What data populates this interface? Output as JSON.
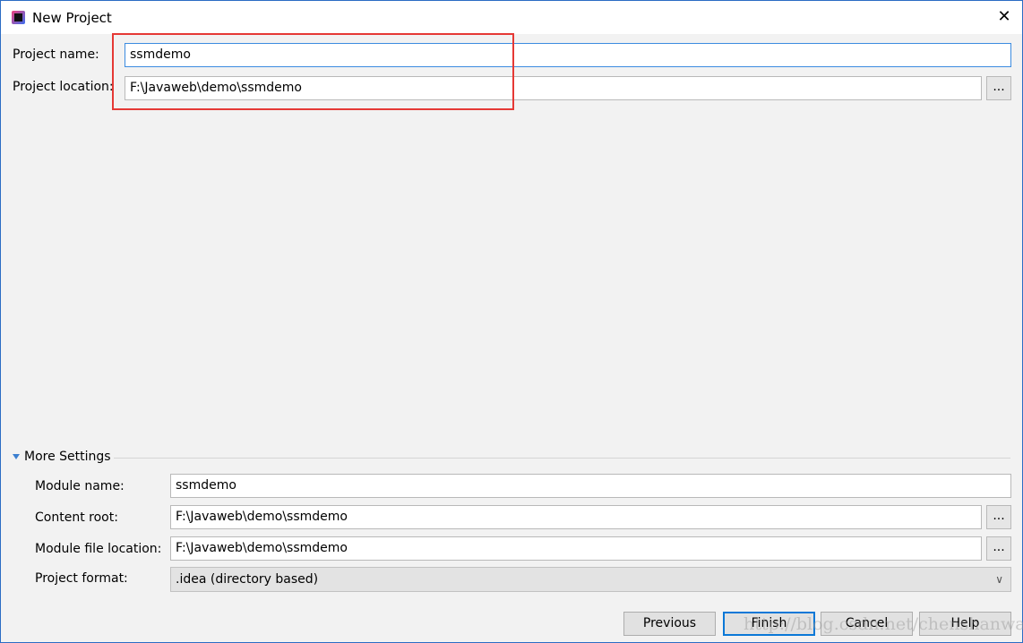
{
  "window": {
    "title": "New Project",
    "close": "✕"
  },
  "project": {
    "name_label": "Project name:",
    "name_value": "ssmdemo",
    "location_label": "Project location:",
    "location_value": "F:\\Javaweb\\demo\\ssmdemo",
    "browse": "..."
  },
  "more_settings": {
    "title": "More Settings",
    "module_name_label": "Module name:",
    "module_name_value": "ssmdemo",
    "content_root_label": "Content root:",
    "content_root_value": "F:\\Javaweb\\demo\\ssmdemo",
    "module_file_label": "Module file location:",
    "module_file_value": "F:\\Javaweb\\demo\\ssmdemo",
    "format_label": "Project format:",
    "format_value": ".idea (directory based)"
  },
  "buttons": {
    "previous": "Previous",
    "finish": "Finish",
    "cancel": "Cancel",
    "help": "Help"
  },
  "watermark": "http://blog.csdn.net/chenshanwa",
  "colors": {
    "highlight": "#e53935",
    "accent": "#0a78d7"
  }
}
